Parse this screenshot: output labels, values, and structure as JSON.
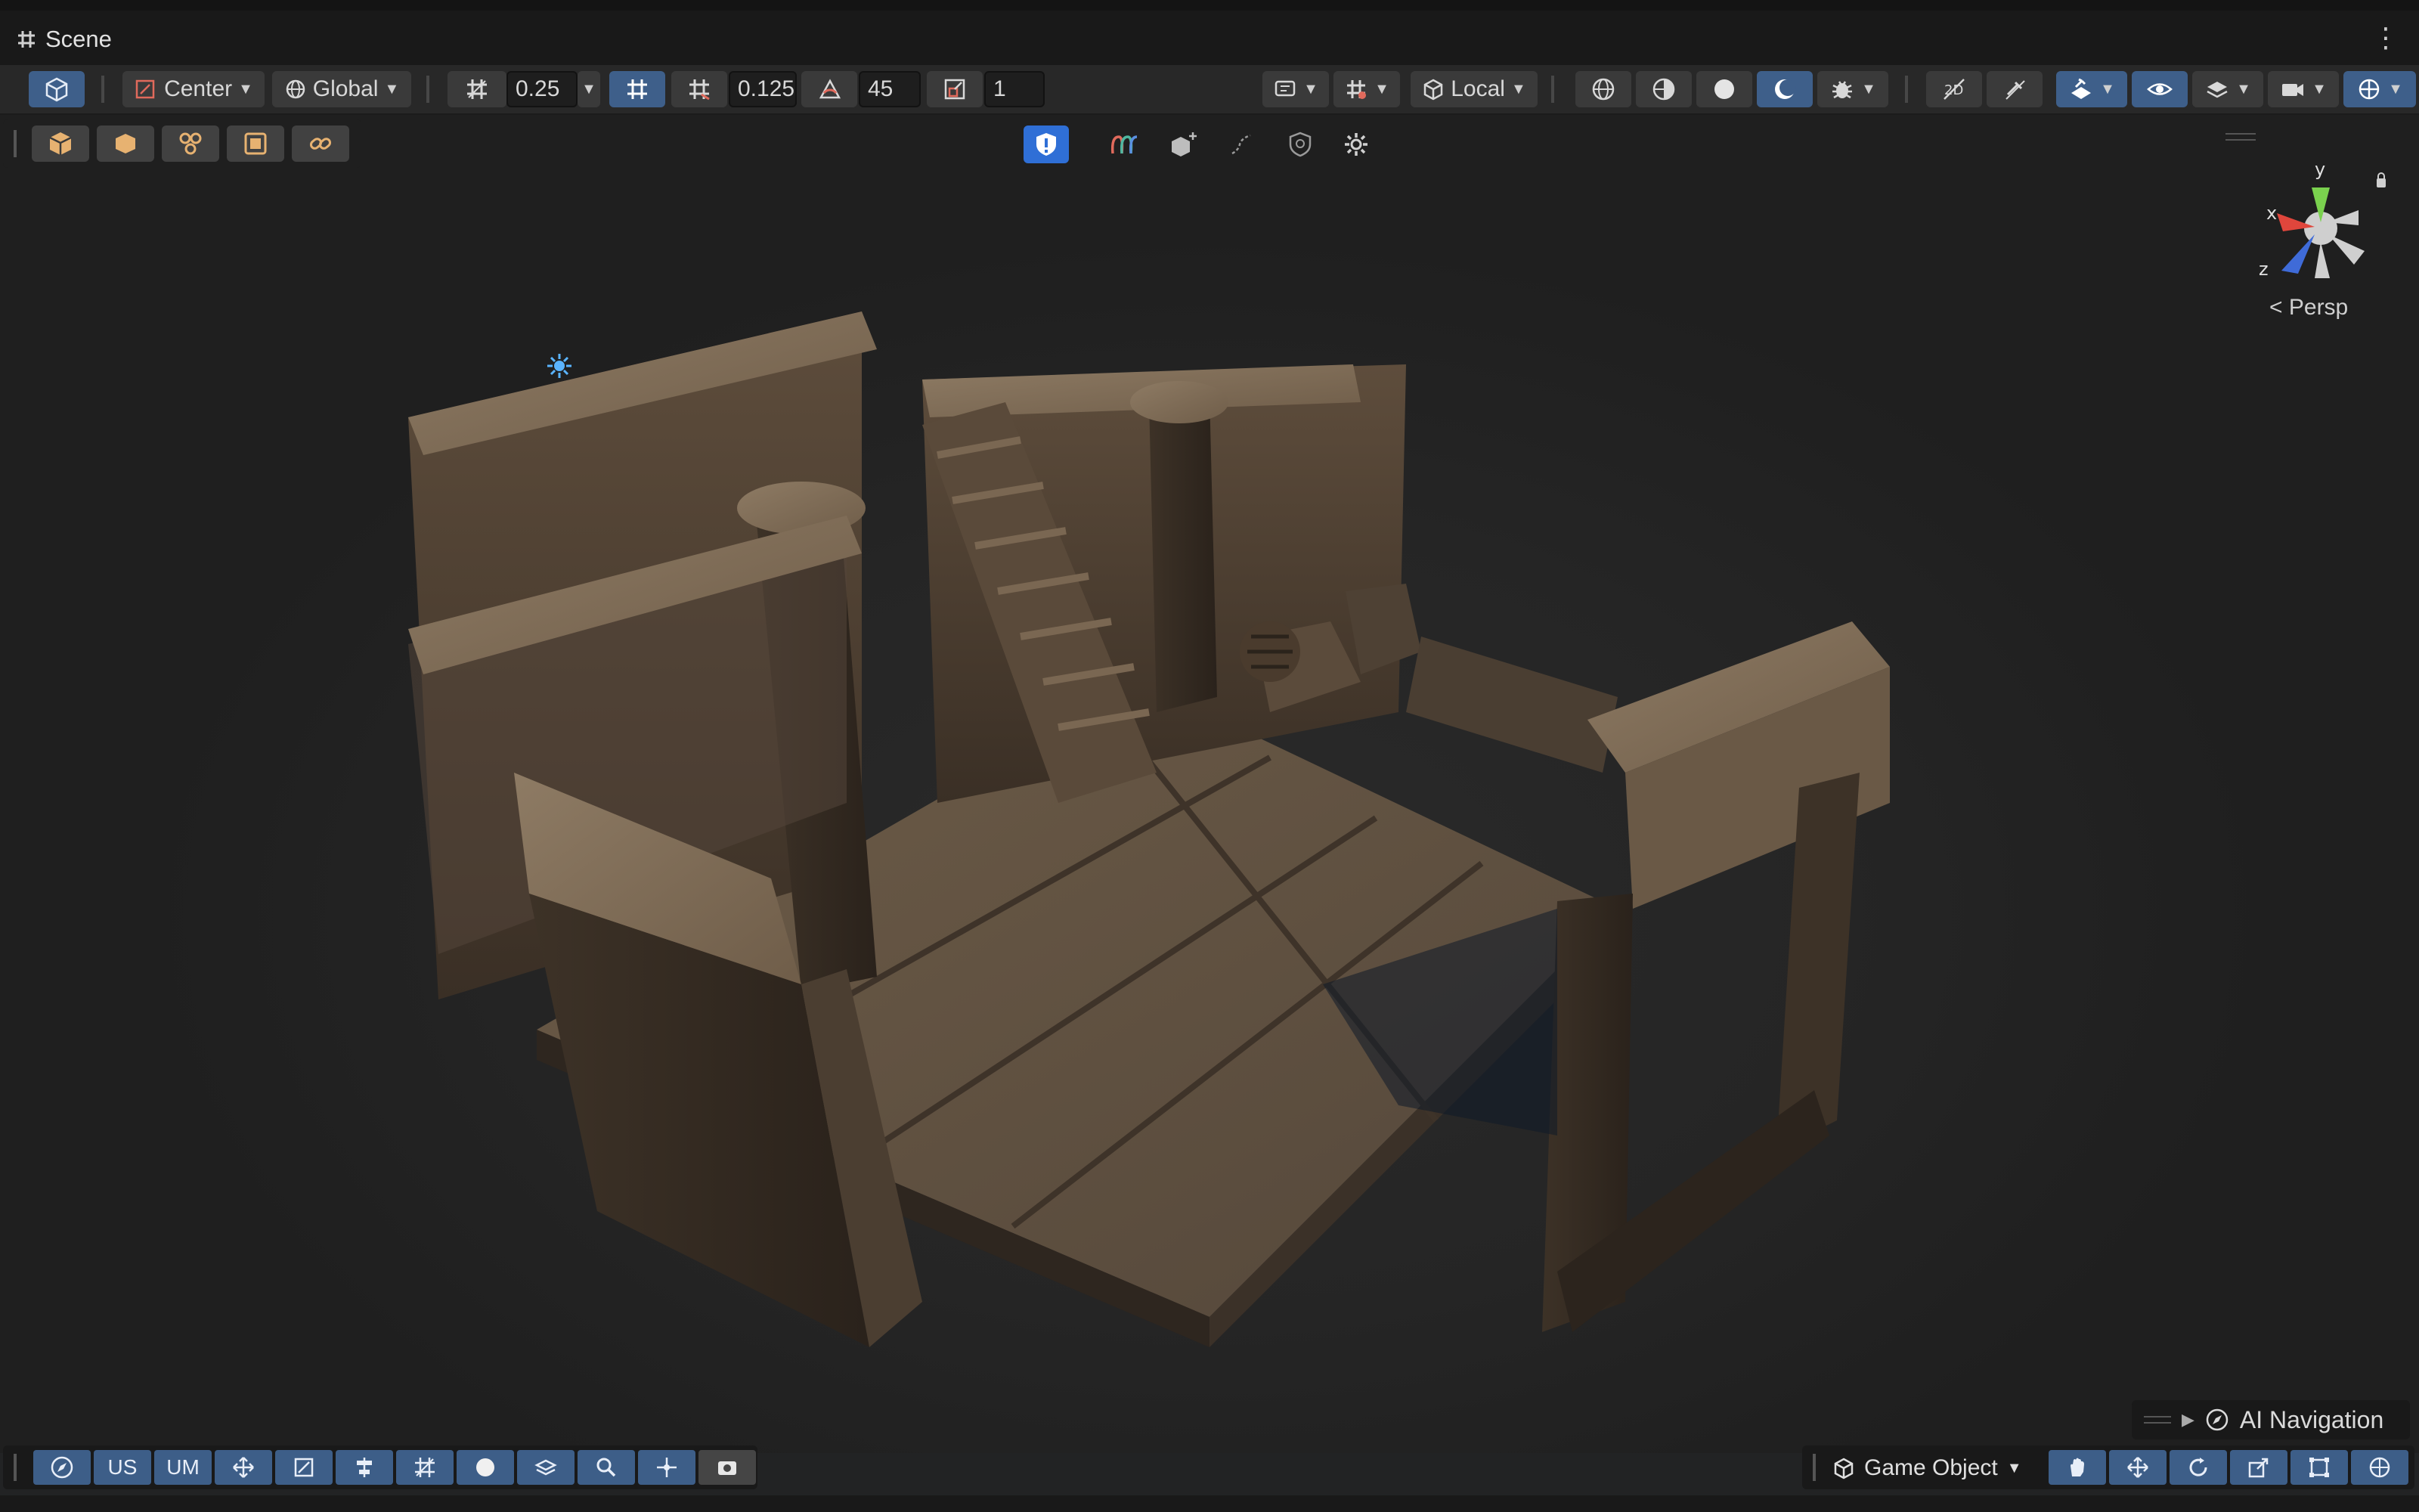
{
  "tab": {
    "title": "Scene",
    "icon": "grid-icon"
  },
  "toolbar": {
    "pivot_label": "Center",
    "space_label": "Global",
    "grid_snap_value": "0.25",
    "move_snap_value": "0.125",
    "rotate_snap_value": "45",
    "scale_snap_value": "1",
    "orientation_label": "Local"
  },
  "viewport": {
    "projection_label": "Persp"
  },
  "gizmo": {
    "x_label": "x",
    "y_label": "y",
    "z_label": "z"
  },
  "ai_navigation": {
    "label": "AI Navigation"
  },
  "bottom_toolbar": {
    "us_label": "US",
    "um_label": "UM",
    "mode_label": "Game Object"
  },
  "colors": {
    "accent": "#3e5f8a",
    "active": "#2f6fd6",
    "background": "#222324"
  }
}
